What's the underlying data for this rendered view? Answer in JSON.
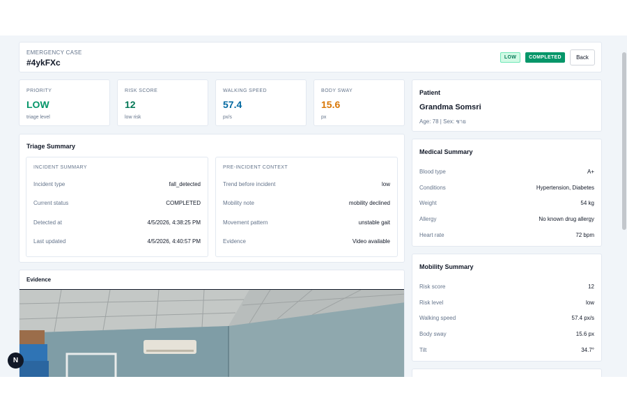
{
  "header": {
    "label": "EMERGENCY CASE",
    "case_id": "#4ykFXc",
    "badge_priority": "LOW",
    "badge_status": "COMPLETED",
    "back_label": "Back"
  },
  "stats": [
    {
      "label": "PRIORITY",
      "value": "LOW",
      "sub": "triage level",
      "color": "#059669"
    },
    {
      "label": "RISK SCORE",
      "value": "12",
      "sub": "low risk",
      "color": "#047857"
    },
    {
      "label": "WALKING SPEED",
      "value": "57.4",
      "sub": "px/s",
      "color": "#0369a1"
    },
    {
      "label": "BODY SWAY",
      "value": "15.6",
      "sub": "px",
      "color": "#d97706"
    }
  ],
  "triage": {
    "title": "Triage Summary",
    "incident": {
      "title": "INCIDENT SUMMARY",
      "rows": [
        {
          "k": "Incident type",
          "v": "fall_detected"
        },
        {
          "k": "Current status",
          "v": "COMPLETED"
        },
        {
          "k": "Detected at",
          "v": "4/5/2026, 4:38:25 PM"
        },
        {
          "k": "Last updated",
          "v": "4/5/2026, 4:40:57 PM"
        }
      ]
    },
    "context": {
      "title": "PRE-INCIDENT CONTEXT",
      "rows": [
        {
          "k": "Trend before incident",
          "v": "low"
        },
        {
          "k": "Mobility note",
          "v": "mobility declined"
        },
        {
          "k": "Movement pattern",
          "v": "unstable gait"
        },
        {
          "k": "Evidence",
          "v": "Video available"
        }
      ]
    }
  },
  "evidence": {
    "title": "Evidence"
  },
  "patient": {
    "label": "Patient",
    "name": "Grandma Somsri",
    "meta": "Age: 78 | Sex: ชาย"
  },
  "medical": {
    "title": "Medical Summary",
    "rows": [
      {
        "k": "Blood type",
        "v": "A+"
      },
      {
        "k": "Conditions",
        "v": "Hypertension, Diabetes"
      },
      {
        "k": "Weight",
        "v": "54 kg"
      },
      {
        "k": "Allergy",
        "v": "No known drug allergy"
      },
      {
        "k": "Heart rate",
        "v": "72 bpm"
      }
    ]
  },
  "mobility": {
    "title": "Mobility Summary",
    "rows": [
      {
        "k": "Risk score",
        "v": "12"
      },
      {
        "k": "Risk level",
        "v": "low"
      },
      {
        "k": "Walking speed",
        "v": "57.4 px/s"
      },
      {
        "k": "Body sway",
        "v": "15.6 px"
      },
      {
        "k": "Tilt",
        "v": "34.7°"
      }
    ]
  },
  "dev_badge": {
    "letter": "N"
  }
}
